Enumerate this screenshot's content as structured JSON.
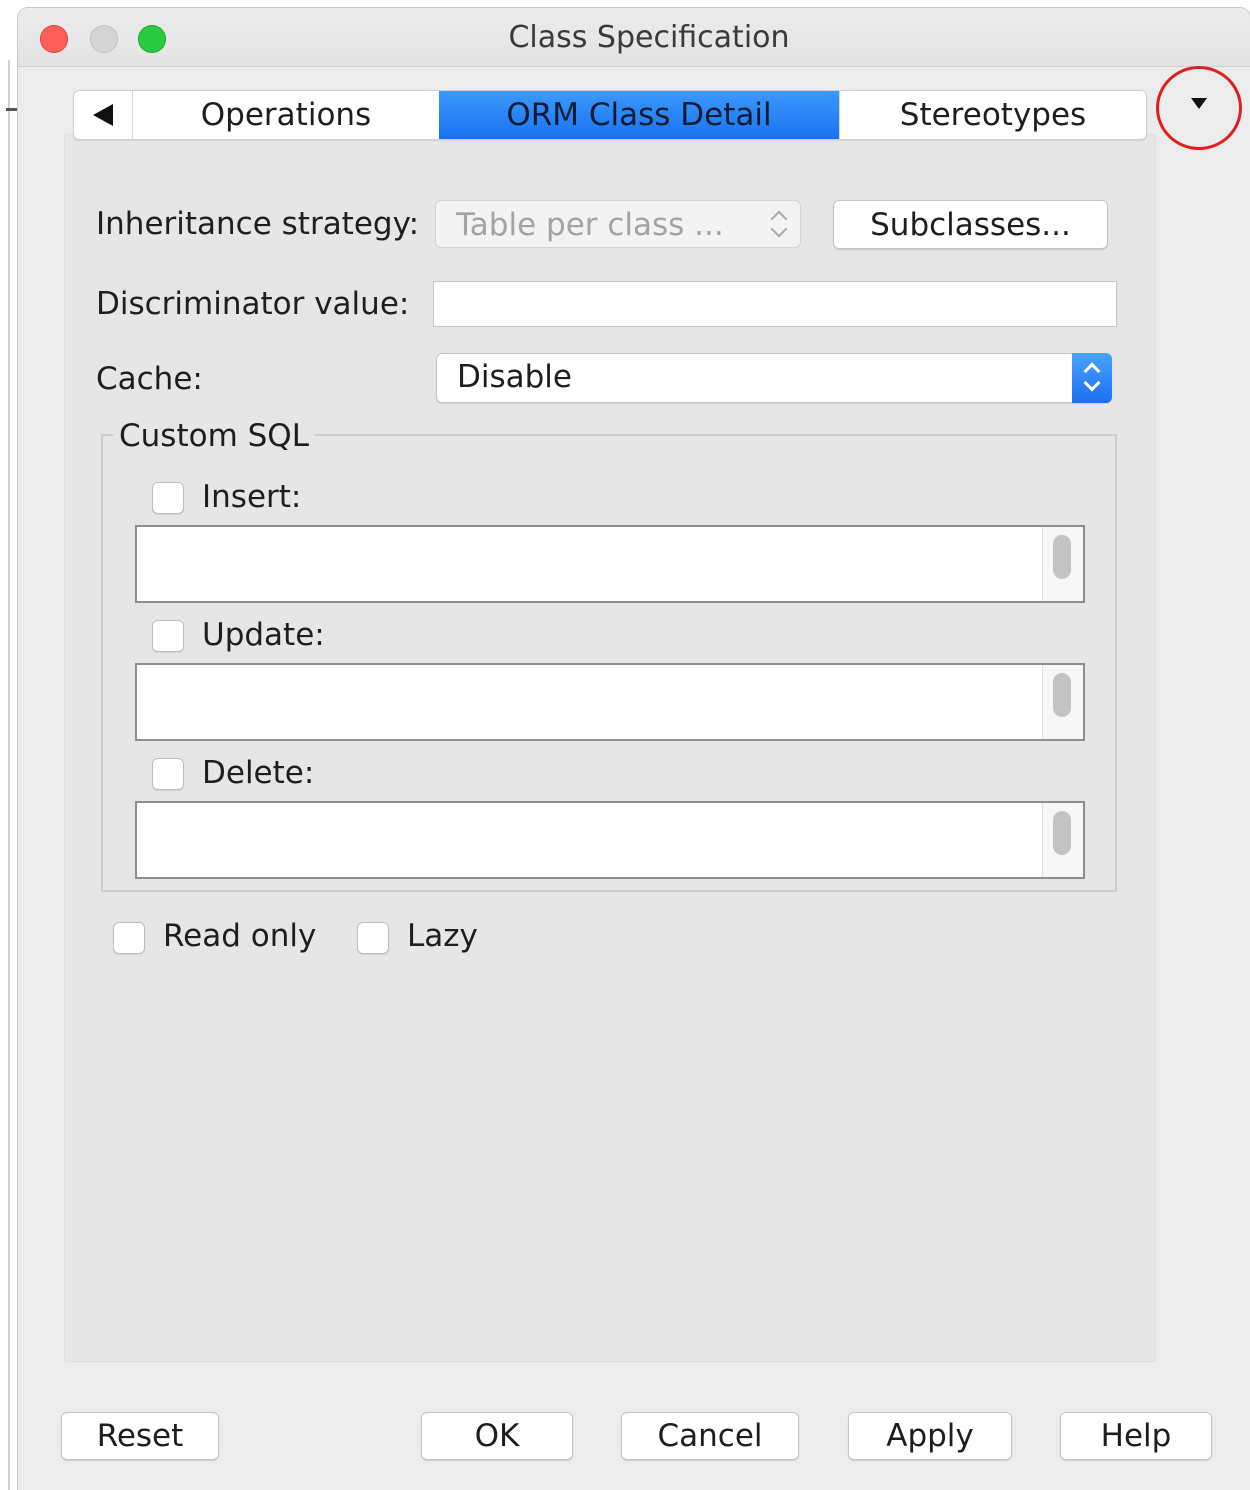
{
  "window": {
    "title": "Class Specification"
  },
  "tabs": {
    "items": [
      {
        "label": "Operations"
      },
      {
        "label": "ORM Class Detail"
      },
      {
        "label": "Stereotypes"
      }
    ],
    "selected": "ORM Class Detail"
  },
  "form": {
    "inheritance_label": "Inheritance strategy:",
    "inheritance_value": "Table per class ...",
    "subclasses_button": "Subclasses...",
    "discriminator_label": "Discriminator value:",
    "discriminator_value": "",
    "cache_label": "Cache:",
    "cache_value": "Disable",
    "custom_sql_title": "Custom SQL",
    "insert_label": "Insert:",
    "update_label": "Update:",
    "delete_label": "Delete:",
    "read_only_label": "Read only",
    "lazy_label": "Lazy"
  },
  "footer": {
    "reset": "Reset",
    "ok": "OK",
    "cancel": "Cancel",
    "apply": "Apply",
    "help": "Help"
  },
  "colors": {
    "selected_tab": "#1a72f0",
    "annotation_circle": "#e0201f",
    "close": "#fc5f57",
    "zoom": "#29c941"
  }
}
